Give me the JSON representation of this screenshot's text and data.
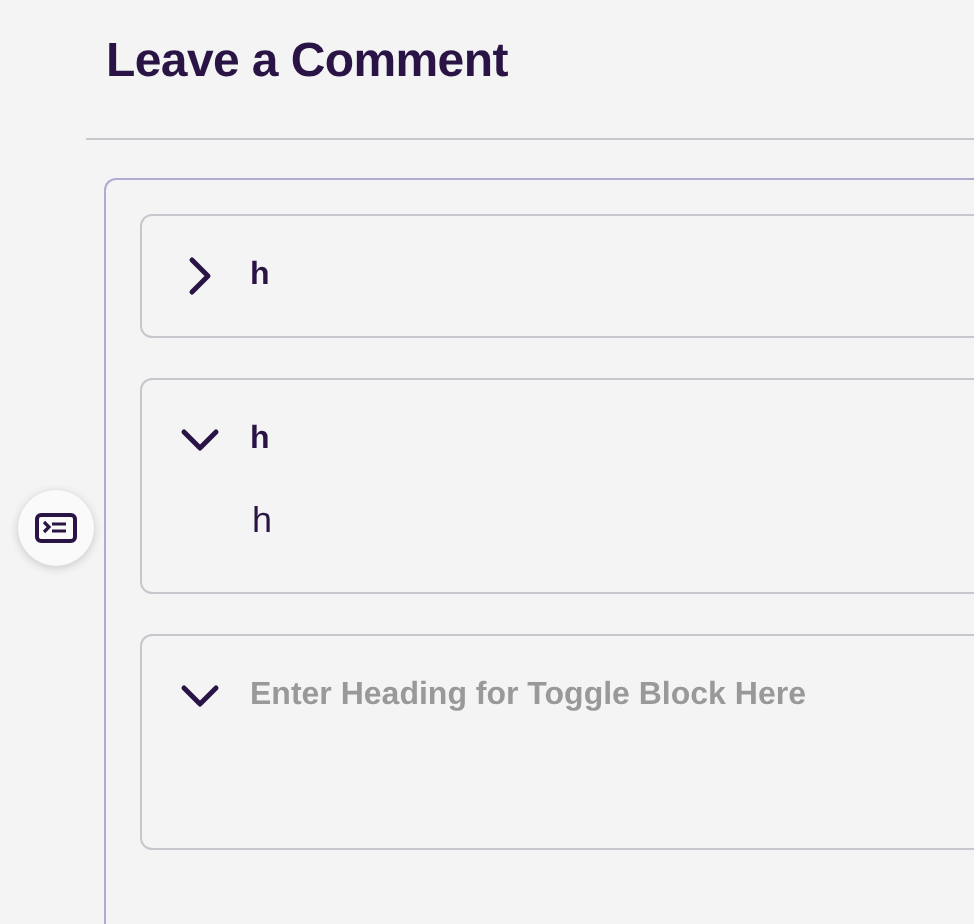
{
  "title": "Leave a Comment",
  "toggles": [
    {
      "heading": "h",
      "expanded": false
    },
    {
      "heading": "h",
      "expanded": true,
      "body": "h"
    },
    {
      "placeholder": "Enter Heading for Toggle Block Here",
      "expanded": true
    }
  ]
}
